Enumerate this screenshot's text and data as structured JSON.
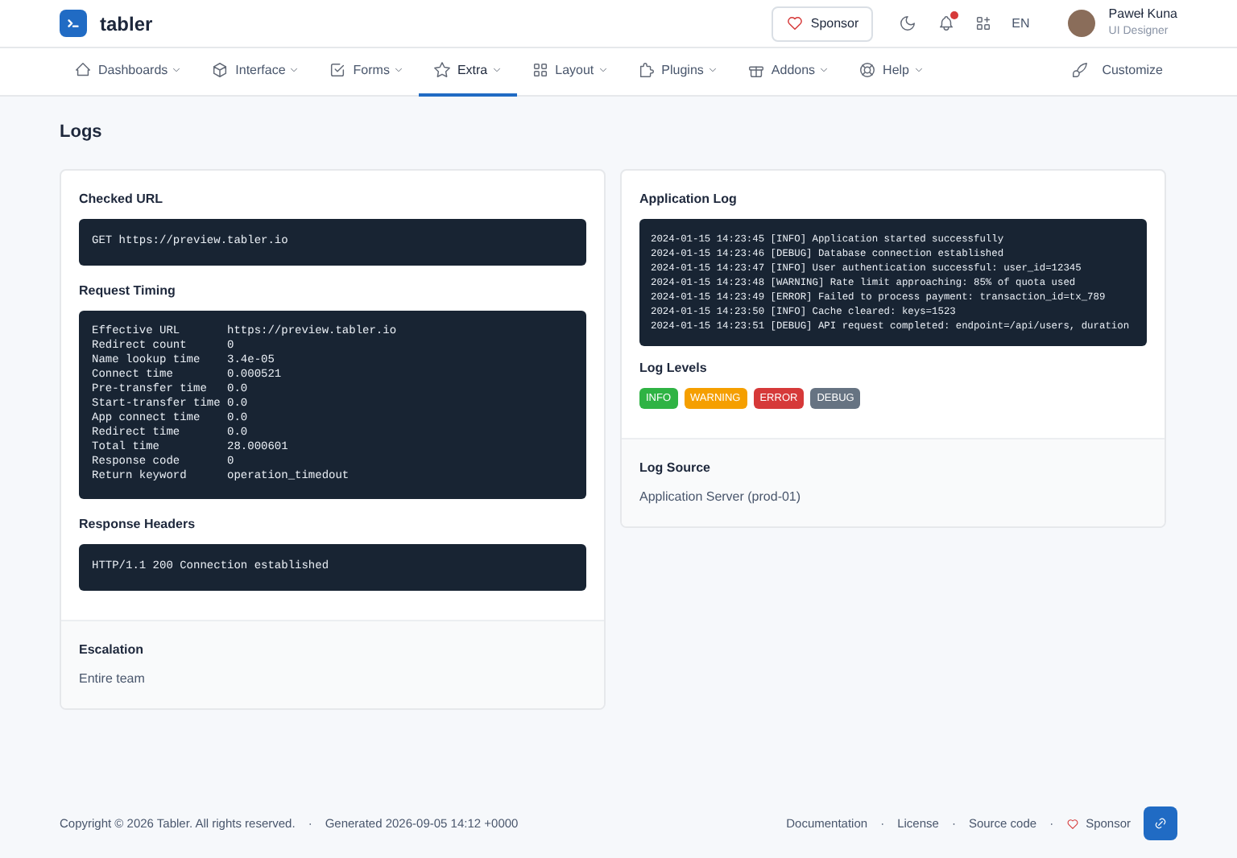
{
  "brand": {
    "name": "tabler"
  },
  "header": {
    "sponsor": "Sponsor",
    "notifications_unread": true,
    "language": "EN",
    "user": {
      "name": "Paweł Kuna",
      "role": "UI Designer"
    }
  },
  "nav": [
    {
      "label": "Dashboards",
      "selected": false
    },
    {
      "label": "Interface",
      "selected": false
    },
    {
      "label": "Forms",
      "selected": false
    },
    {
      "label": "Extra",
      "selected": true
    },
    {
      "label": "Layout",
      "selected": false
    },
    {
      "label": "Plugins",
      "selected": false
    },
    {
      "label": "Addons",
      "selected": false
    },
    {
      "label": "Help",
      "selected": false
    }
  ],
  "customize": "Customize",
  "page_title": "Logs",
  "left_card": {
    "sections": [
      {
        "title": "Checked URL",
        "lines": [
          [
            "GET https://preview.tabler.io"
          ]
        ]
      },
      {
        "title": "Request Timing",
        "lines": [
          [
            "Effective URL",
            "https://preview.tabler.io"
          ],
          [
            "Redirect count",
            "0"
          ],
          [
            "Name lookup time",
            "3.4e-05"
          ],
          [
            "Connect time",
            "0.000521"
          ],
          [
            "Pre-transfer time",
            "0.0"
          ],
          [
            "Start-transfer time",
            "0.0"
          ],
          [
            "App connect time",
            "0.0"
          ],
          [
            "Redirect time",
            "0.0"
          ],
          [
            "Total time",
            "28.000601"
          ],
          [
            "Response code",
            "0"
          ],
          [
            "Return keyword",
            "operation_timedout"
          ]
        ]
      },
      {
        "title": "Response Headers",
        "lines": [
          [
            "HTTP/1.1 200 Connection established"
          ]
        ]
      }
    ],
    "footer": {
      "title": "Escalation",
      "text": "Entire team"
    }
  },
  "right_card": {
    "log_title": "Application Log",
    "log_lines": [
      "2024-01-15 14:23:45 [INFO] Application started successfully",
      "2024-01-15 14:23:46 [DEBUG] Database connection established",
      "2024-01-15 14:23:47 [INFO] User authentication successful: user_id=12345",
      "2024-01-15 14:23:48 [WARNING] Rate limit approaching: 85% of quota used",
      "2024-01-15 14:23:49 [ERROR] Failed to process payment: transaction_id=tx_789",
      "2024-01-15 14:23:50 [INFO] Cache cleared: keys=1523",
      "2024-01-15 14:23:51 [DEBUG] API request completed: endpoint=/api/users, duration"
    ],
    "levels_title": "Log Levels",
    "levels": [
      {
        "label": "INFO",
        "color": "#2fb344"
      },
      {
        "label": "WARNING",
        "color": "#f59f00"
      },
      {
        "label": "ERROR",
        "color": "#d63939"
      },
      {
        "label": "DEBUG",
        "color": "#667382"
      }
    ],
    "footer": {
      "title": "Log Source",
      "text": "Application Server (prod-01)"
    }
  },
  "footer": {
    "left": [
      {
        "kind": "text",
        "text": "Copyright © 2026 Tabler. All rights reserved."
      },
      {
        "kind": "separator",
        "text": "·"
      },
      {
        "kind": "text",
        "text": "Generated 2026-09-05 14:12 +0000"
      }
    ],
    "right": [
      {
        "kind": "link",
        "text": "Documentation"
      },
      {
        "kind": "separator",
        "text": "·"
      },
      {
        "kind": "link",
        "text": "License"
      },
      {
        "kind": "separator",
        "text": "·"
      },
      {
        "kind": "link",
        "text": "Source code"
      },
      {
        "kind": "separator",
        "text": "·"
      },
      {
        "kind": "sponsor",
        "text": "Sponsor"
      }
    ]
  }
}
